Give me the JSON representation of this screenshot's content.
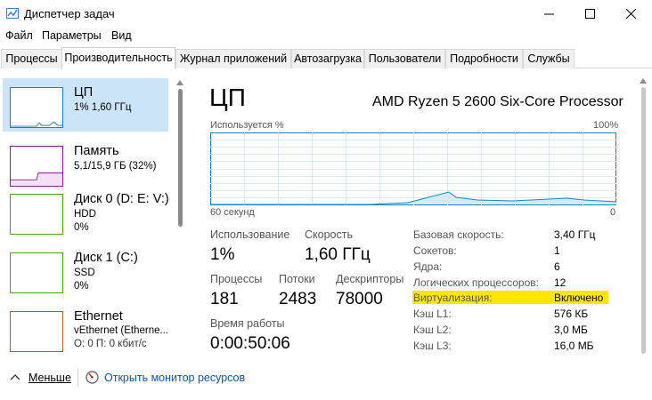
{
  "window": {
    "title": "Диспетчер задач"
  },
  "menu": [
    "Файл",
    "Параметры",
    "Вид"
  ],
  "tabs": [
    {
      "label": "Процессы",
      "active": false
    },
    {
      "label": "Производительность",
      "active": true
    },
    {
      "label": "Журнал приложений",
      "active": false
    },
    {
      "label": "Автозагрузка",
      "active": false
    },
    {
      "label": "Пользователи",
      "active": false
    },
    {
      "label": "Подробности",
      "active": false
    },
    {
      "label": "Службы",
      "active": false
    }
  ],
  "sidebar": [
    {
      "title": "ЦП",
      "sub1": "1% 1,60 ГГц",
      "sub2": "",
      "color": "#1187c6",
      "selected": true
    },
    {
      "title": "Память",
      "sub1": "5,1/15,9 ГБ (32%)",
      "sub2": "",
      "color": "#8b1a93",
      "selected": false
    },
    {
      "title": "Диск 0 (D: E: V:)",
      "sub1": "HDD",
      "sub2": "0%",
      "color": "#4da60c",
      "selected": false
    },
    {
      "title": "Диск 1 (C:)",
      "sub1": "SSD",
      "sub2": "0%",
      "color": "#4da60c",
      "selected": false
    },
    {
      "title": "Ethernet",
      "sub1": "vEthernet (Etherne...",
      "sub2": "О: 0 П: 0 кбит/с",
      "color": "#a5651a",
      "selected": false
    }
  ],
  "detail": {
    "heading": "ЦП",
    "model": "AMD Ryzen 5 2600 Six-Core Processor",
    "graph_label": "Используется %",
    "graph_max": "100%",
    "graph_time": "60 секунд",
    "graph_min": "0",
    "usage_label": "Использование",
    "usage_value": "1%",
    "speed_label": "Скорость",
    "speed_value": "1,60 ГГц",
    "processes_label": "Процессы",
    "processes_value": "181",
    "threads_label": "Потоки",
    "threads_value": "2483",
    "handles_label": "Дескрипторы",
    "handles_value": "78000",
    "uptime_label": "Время работы",
    "uptime_value": "0:00:50:06",
    "specs": [
      {
        "label": "Базовая скорость:",
        "value": "3,40 ГГц"
      },
      {
        "label": "Сокетов:",
        "value": "1"
      },
      {
        "label": "Ядра:",
        "value": "6"
      },
      {
        "label": "Логических процессоров:",
        "value": "12"
      },
      {
        "label": "Виртуализация:",
        "value": "Включено",
        "highlight": "#ffe600"
      },
      {
        "label": "Кэш L1:",
        "value": "576 КБ"
      },
      {
        "label": "Кэш L2:",
        "value": "3,0 МБ"
      },
      {
        "label": "Кэш L3:",
        "value": "16,0 МБ"
      }
    ]
  },
  "footer": {
    "less_label": "Меньше",
    "monitor_link": "Открыть монитор ресурсов"
  },
  "colors": {
    "accent": "#1187c6",
    "selected_bg": "#cce4f7",
    "graph_fill": "#d4ebf7",
    "link": "#0a58a6"
  }
}
